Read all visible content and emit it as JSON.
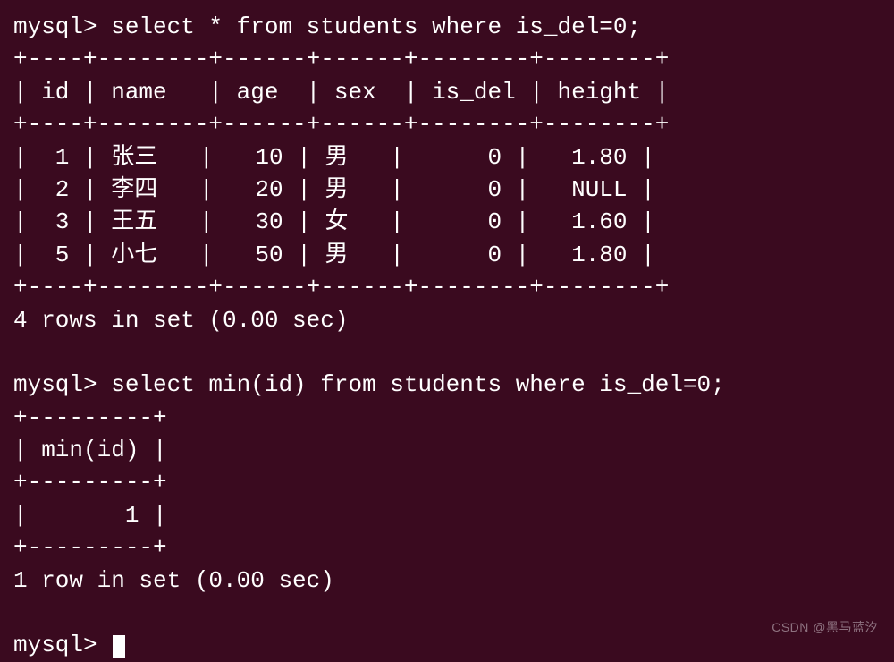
{
  "prompt": "mysql> ",
  "queries": [
    {
      "sql": "select * from students where is_del=0;",
      "result_border_top": "+----+--------+------+------+--------+--------+",
      "result_header": "| id | name   | age  | sex  | is_del | height |",
      "result_border_mid": "+----+--------+------+------+--------+--------+",
      "result_rows": [
        "|  1 | 张三   |   10 | 男   |      0 |   1.80 |",
        "|  2 | 李四   |   20 | 男   |      0 |   NULL |",
        "|  3 | 王五   |   30 | 女   |      0 |   1.60 |",
        "|  5 | 小七   |   50 | 男   |      0 |   1.80 |"
      ],
      "result_border_bot": "+----+--------+------+------+--------+--------+",
      "summary": "4 rows in set (0.00 sec)"
    },
    {
      "sql": "select min(id) from students where is_del=0;",
      "result_border_top": "+---------+",
      "result_header": "| min(id) |",
      "result_border_mid": "+---------+",
      "result_rows": [
        "|       1 |"
      ],
      "result_border_bot": "+---------+",
      "summary": "1 row in set (0.00 sec)"
    }
  ],
  "chart_data": {
    "type": "table",
    "title": "students where is_del=0",
    "columns": [
      "id",
      "name",
      "age",
      "sex",
      "is_del",
      "height"
    ],
    "rows": [
      {
        "id": 1,
        "name": "张三",
        "age": 10,
        "sex": "男",
        "is_del": 0,
        "height": 1.8
      },
      {
        "id": 2,
        "name": "李四",
        "age": 20,
        "sex": "男",
        "is_del": 0,
        "height": null
      },
      {
        "id": 3,
        "name": "王五",
        "age": 30,
        "sex": "女",
        "is_del": 0,
        "height": 1.6
      },
      {
        "id": 5,
        "name": "小七",
        "age": 50,
        "sex": "男",
        "is_del": 0,
        "height": 1.8
      }
    ],
    "aggregate": {
      "function": "min",
      "column": "id",
      "value": 1
    }
  },
  "watermark": "CSDN @黑马蓝汐"
}
